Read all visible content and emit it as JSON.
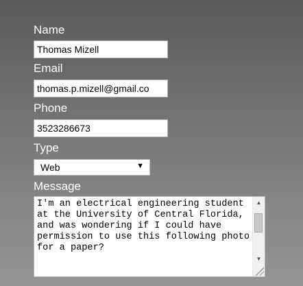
{
  "form": {
    "name_label": "Name",
    "name_value": "Thomas Mizell",
    "email_label": "Email",
    "email_value": "thomas.p.mizell@gmail.co",
    "phone_label": "Phone",
    "phone_value": "3523286673",
    "type_label": "Type",
    "type_selected": "Web",
    "message_label": "Message",
    "message_value": "I'm an electrical engineering student at the University of Central Florida, and was wondering if I could have permission to use this following photo for a paper?"
  },
  "icons": {
    "select_arrow": "triangle-down",
    "scroll_up": "triangle-up",
    "scroll_down": "triangle-down",
    "resize": "resize-grip"
  }
}
